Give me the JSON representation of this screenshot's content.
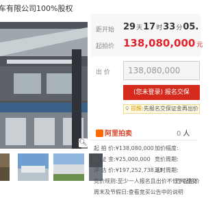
{
  "title": "车有限公司100%股权",
  "countdown": {
    "label": "距开始",
    "days": "29",
    "hours": "17",
    "minutes": "33",
    "seconds": "05.",
    "u_day": "天",
    "u_hour": "时",
    "u_min": "分"
  },
  "start_price": {
    "label": "起拍价",
    "value": "138,080,000",
    "unit": "元"
  },
  "bid": {
    "label": "出 价",
    "value": "138,080,000"
  },
  "bid_button": "(您未登录) 报名交保",
  "reminder": {
    "label": "提醒:",
    "text": "先报名交保证金再出价"
  },
  "platform": {
    "name": "阿里拍卖"
  },
  "count": {
    "value": "0",
    "unit": "人"
  },
  "details_left": [
    {
      "label": "起 拍 价:",
      "value": "¥138,080,000"
    },
    {
      "label": "保 证 金:",
      "value": "¥25,000,000"
    },
    {
      "label": "评 估 价:",
      "value": "¥197,252,738.33"
    },
    {
      "label": "竞价规则:",
      "value": "至少一人报名且出价不低于起拍价"
    },
    {
      "label": "周末及节假日:",
      "value": "查看竞买公告中的说明"
    }
  ],
  "details_right": [
    {
      "label": "加价幅度:"
    },
    {
      "label": "竞价周期:"
    },
    {
      "label": "延时周期:"
    },
    {
      "label": "方可成交"
    }
  ],
  "colors": {
    "accent_red": "#e0232b",
    "button_red": "#d52b1e",
    "ali_orange": "#ff6a00"
  },
  "icons": {
    "zoom": "magnifier-icon",
    "remind": "bulb-icon",
    "logo": "aliyun-logo-icon"
  }
}
